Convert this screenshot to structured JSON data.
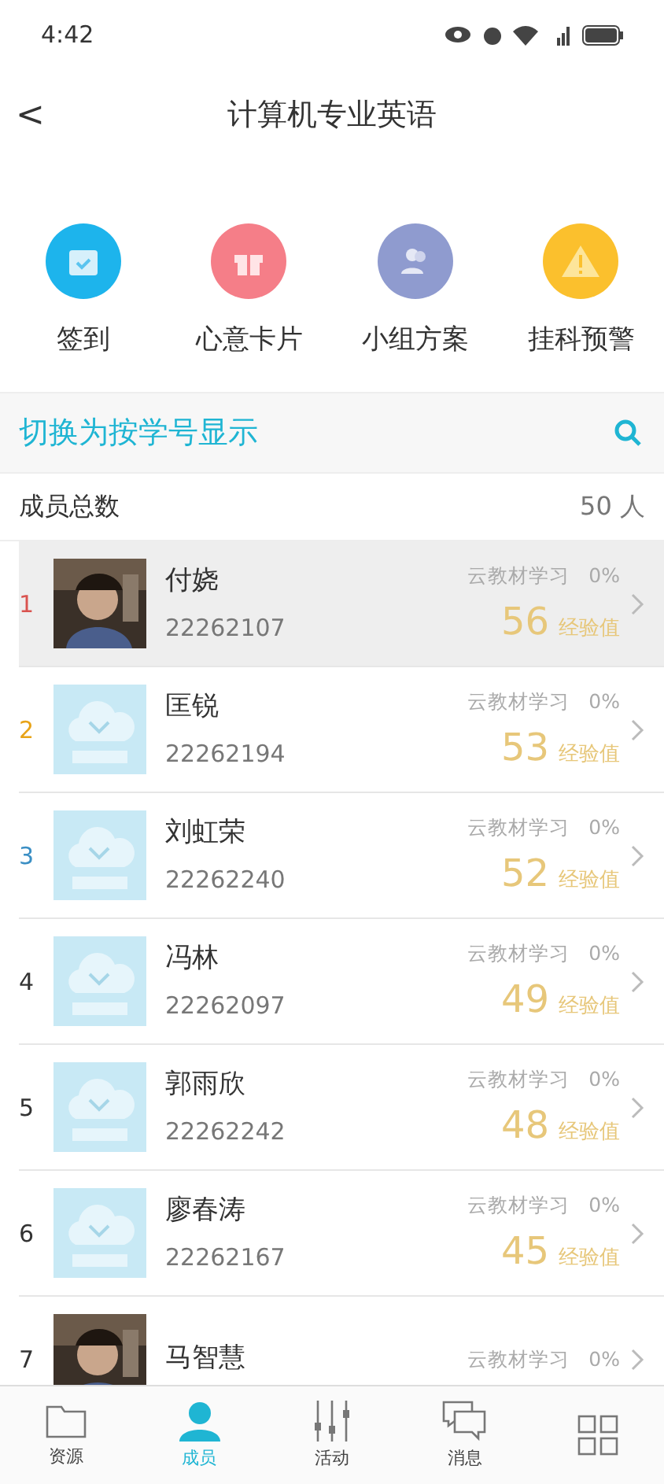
{
  "status_bar": {
    "time": "4:42"
  },
  "header": {
    "back": "<",
    "title": "计算机专业英语"
  },
  "actions": [
    {
      "kind": "calendar",
      "label": "签到"
    },
    {
      "kind": "gift",
      "label": "心意卡片"
    },
    {
      "kind": "group",
      "label": "小组方案"
    },
    {
      "kind": "warning",
      "label": "挂科预警"
    }
  ],
  "switch_bar": {
    "label": "切换为按学号显示"
  },
  "summary": {
    "label": "成员总数",
    "count": "50 人"
  },
  "members": [
    {
      "rank": "1",
      "color": "#d9534f",
      "kind": "picture",
      "selected": true,
      "name": "付娆",
      "id": "22262107",
      "study": "云教材学习",
      "percent": "0%",
      "score": "56",
      "unit": "经验值"
    },
    {
      "rank": "2",
      "color": "#e8a317",
      "kind": "placeholder",
      "selected": false,
      "name": "匡锐",
      "id": "22262194",
      "study": "云教材学习",
      "percent": "0%",
      "score": "53",
      "unit": "经验值"
    },
    {
      "rank": "3",
      "color": "#3b8fc4",
      "kind": "placeholder",
      "selected": false,
      "name": "刘虹荣",
      "id": "22262240",
      "study": "云教材学习",
      "percent": "0%",
      "score": "52",
      "unit": "经验值"
    },
    {
      "rank": "4",
      "color": "#333333",
      "kind": "placeholder",
      "selected": false,
      "name": "冯林",
      "id": "22262097",
      "study": "云教材学习",
      "percent": "0%",
      "score": "49",
      "unit": "经验值"
    },
    {
      "rank": "5",
      "color": "#333333",
      "kind": "placeholder",
      "selected": false,
      "name": "郭雨欣",
      "id": "22262242",
      "study": "云教材学习",
      "percent": "0%",
      "score": "48",
      "unit": "经验值"
    },
    {
      "rank": "6",
      "color": "#333333",
      "kind": "placeholder",
      "selected": false,
      "name": "廖春涛",
      "id": "22262167",
      "study": "云教材学习",
      "percent": "0%",
      "score": "45",
      "unit": "经验值"
    },
    {
      "rank": "7",
      "color": "#333333",
      "kind": "picture",
      "selected": false,
      "name": "马智慧",
      "study": "云教材学习",
      "percent": "0%"
    }
  ],
  "tabs": [
    {
      "kind": "folder",
      "label": "资源",
      "selected": false
    },
    {
      "kind": "person",
      "label": "成员",
      "selected": true
    },
    {
      "kind": "sliders",
      "label": "活动",
      "selected": false
    },
    {
      "kind": "chat",
      "label": "消息",
      "selected": false
    },
    {
      "kind": "grid",
      "selected": false
    }
  ]
}
